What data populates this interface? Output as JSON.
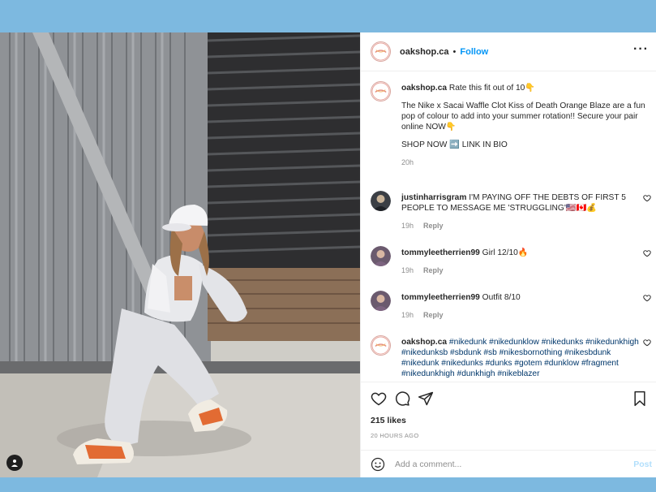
{
  "post": {
    "username": "oakshop.ca",
    "separator": "•",
    "follow_label": "Follow",
    "more_label": "···",
    "caption": {
      "username": "oakshop.ca",
      "line1": "Rate this fit out of 10👇",
      "para2": "The Nike x Sacai Waffle Clot Kiss of Death Orange Blaze are a fun pop of colour to add into your summer rotation!! Secure your pair online NOW👇",
      "para3": "SHOP NOW ➡️ LINK IN BIO",
      "age": "20h"
    },
    "comments": [
      {
        "username": "justinharrisgram",
        "text": "I'M PAYING OFF THE DEBTS OF FIRST 5 PEOPLE TO MESSAGE ME 'STRUGGLING'🇺🇸🇨🇦💰",
        "age": "19h",
        "reply": "Reply"
      },
      {
        "username": "tommyleetherrien99",
        "text": "Girl 12/10🔥",
        "age": "19h",
        "reply": "Reply"
      },
      {
        "username": "tommyleetherrien99",
        "text": "Outfit 8/10",
        "age": "19h",
        "reply": "Reply"
      },
      {
        "username": "oakshop.ca",
        "text": "#nikedunk #nikedunklow #nikedunks #nikedunkhigh #nikedunksb #sbdunk #sb #nikesbornothing #nikesbdunk #nikedunk #nikedunks #dunks #gotem #dunklow #fragment #nikedunkhigh #dunkhigh #nikeblazer"
      }
    ],
    "likes": "215 likes",
    "timestamp": "20 HOURS AGO",
    "comment_placeholder": "Add a comment...",
    "post_label": "Post"
  },
  "icons": {
    "like": "heart-icon",
    "comment": "comment-bubble-icon",
    "share": "paper-plane-icon",
    "save": "bookmark-icon",
    "emoji": "smiley-icon",
    "more": "ellipsis-icon",
    "tag": "person-tag-icon"
  },
  "colors": {
    "background": "#7db9e0",
    "link": "#0095f6",
    "hashtag": "#00376b",
    "muted": "#8e8e8e",
    "post_disabled": "#b2dffc"
  }
}
